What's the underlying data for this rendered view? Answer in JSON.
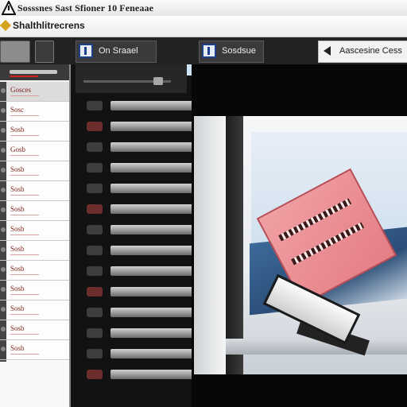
{
  "window": {
    "title": "Sosssnes Sast Sfioner 10 Feneaae"
  },
  "toolbar": {
    "title": "Shalthlitrecrens"
  },
  "tabs": [
    {
      "label": "On Sraael"
    },
    {
      "label": "Sosdsue"
    },
    {
      "label": "Aascesine Cess"
    }
  ],
  "file_list": {
    "items": [
      {
        "label": "Gosces"
      },
      {
        "label": "Sosc"
      },
      {
        "label": "Sosb"
      },
      {
        "label": "Gosb"
      },
      {
        "label": "Sosb"
      },
      {
        "label": "Sosb"
      },
      {
        "label": "Sosb"
      },
      {
        "label": "Sosb"
      },
      {
        "label": "Sosb"
      },
      {
        "label": "Sosb"
      },
      {
        "label": "Sosb"
      },
      {
        "label": "Sosb"
      },
      {
        "label": "Sosb"
      },
      {
        "label": "Sosb"
      },
      {
        "label": "Sosb"
      }
    ]
  },
  "colors": {
    "accent": "#1e3f8c",
    "list_text": "#7a1d12",
    "warning": "#d7a51d"
  },
  "icons": {
    "app": "warning-triangle-icon",
    "toolbar": "diamond-icon",
    "tab": "document-icon",
    "tab_alt": "speaker-icon"
  }
}
